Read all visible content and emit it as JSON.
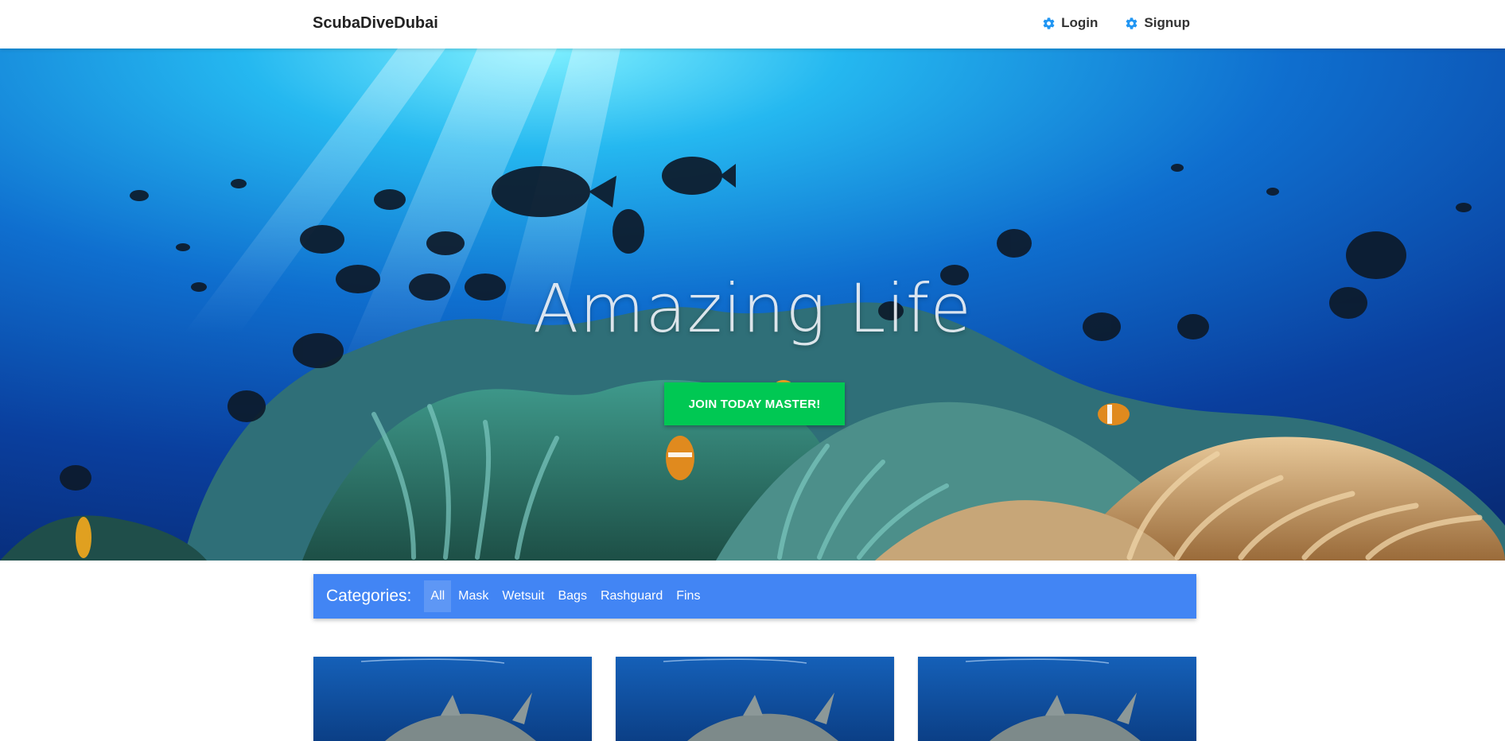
{
  "nav": {
    "brand": "ScubaDiveDubai",
    "links": [
      {
        "label": "Login",
        "icon": "gear-icon"
      },
      {
        "label": "Signup",
        "icon": "gear-icon"
      }
    ]
  },
  "hero": {
    "title": "Amazing Life",
    "cta": "JOIN TODAY MASTER!"
  },
  "categories": {
    "label": "Categories:",
    "items": [
      "All",
      "Mask",
      "Wetsuit",
      "Bags",
      "Rashguard",
      "Fins"
    ],
    "active": "All"
  },
  "cards": [
    {
      "image": "shark-underwater-image"
    },
    {
      "image": "shark-underwater-image"
    },
    {
      "image": "shark-underwater-image"
    }
  ],
  "colors": {
    "accent": "#4285f4",
    "cta": "#00c853",
    "icon": "#2196f3"
  }
}
